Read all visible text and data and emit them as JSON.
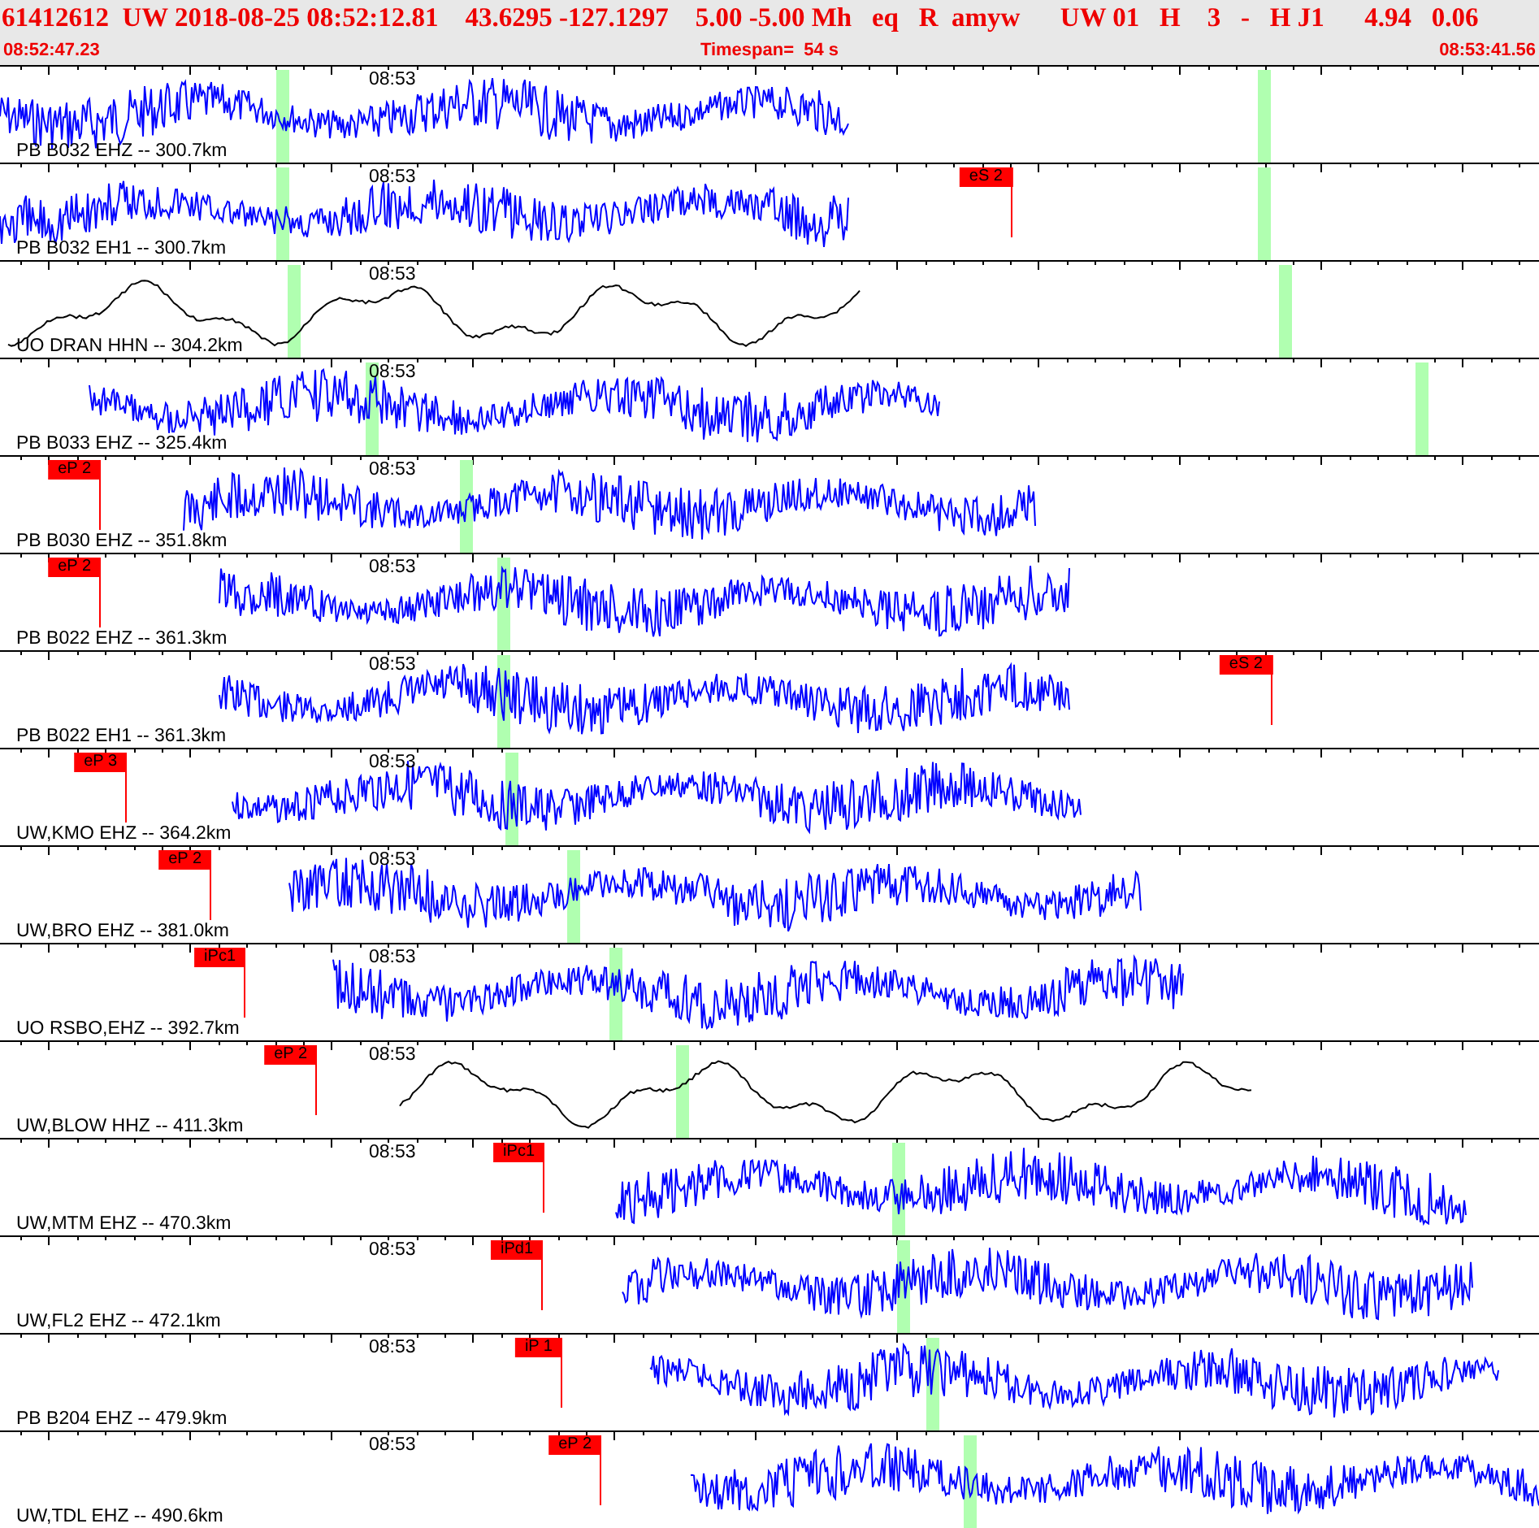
{
  "header": {
    "event_line": "61412612  UW 2018-08-25 08:52:12.81    43.6295 -127.1297    5.00 -5.00 Mh   eq   R  amyw      UW 01   H    3   -   H J1      4.94   0.06",
    "start_time": "08:52:47.23",
    "timespan": "Timespan=  54 s",
    "end_time": "08:53:41.56"
  },
  "traces": [
    {
      "label": "PB B032 EHZ -- 300.7km",
      "time_label": "08:53",
      "color": "#0000ff"
    },
    {
      "label": "PB B032 EH1 -- 300.7km",
      "time_label": "08:53",
      "color": "#0000ff",
      "pick": "eS 2"
    },
    {
      "label": "UO DRAN HHN -- 304.2km",
      "time_label": "08:53",
      "color": "#000000"
    },
    {
      "label": "PB B033 EHZ -- 325.4km",
      "time_label": "08:53",
      "color": "#0000ff"
    },
    {
      "label": "PB B030 EHZ -- 351.8km",
      "time_label": "08:53",
      "color": "#0000ff",
      "pick": "eP 2"
    },
    {
      "label": "PB B022 EHZ -- 361.3km",
      "time_label": "08:53",
      "color": "#0000ff",
      "pick": "eP 2"
    },
    {
      "label": "PB B022 EH1 -- 361.3km",
      "time_label": "08:53",
      "color": "#0000ff",
      "pick": "eS 2"
    },
    {
      "label": "UW,KMO EHZ -- 364.2km",
      "time_label": "08:53",
      "color": "#0000ff",
      "pick": "eP 3"
    },
    {
      "label": "UW,BRO EHZ -- 381.0km",
      "time_label": "08:53",
      "color": "#0000ff",
      "pick": "eP 2"
    },
    {
      "label": "UO RSBO,EHZ -- 392.7km",
      "time_label": "08:53",
      "color": "#0000ff",
      "pick": "iPc1"
    },
    {
      "label": "UW,BLOW HHZ -- 411.3km",
      "time_label": "08:53",
      "color": "#000000",
      "pick": "eP 2"
    },
    {
      "label": "UW,MTM EHZ -- 470.3km",
      "time_label": "08:53",
      "color": "#0000ff",
      "pick": "iPc1"
    },
    {
      "label": "UW,FL2 EHZ -- 472.1km",
      "time_label": "08:53",
      "color": "#0000ff",
      "pick": "iPd1"
    },
    {
      "label": "PB B204 EHZ -- 479.9km",
      "time_label": "08:53",
      "color": "#0000ff",
      "pick": "iP 1"
    },
    {
      "label": "UW,TDL EHZ -- 490.6km",
      "time_label": "08:53",
      "color": "#0000ff",
      "pick": "eP 2"
    }
  ]
}
